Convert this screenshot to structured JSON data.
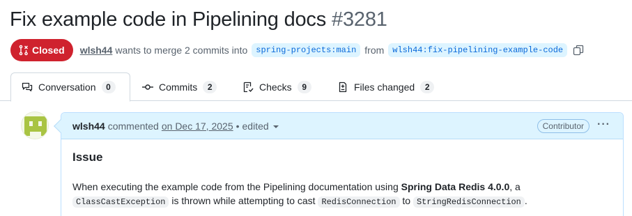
{
  "pr": {
    "title": "Fix example code in Pipelining docs",
    "number": "#3281",
    "state": "Closed",
    "author": "wlsh44",
    "merge_text": "wants to merge 2 commits into",
    "base_branch": "spring-projects:main",
    "from_text": "from",
    "head_branch": "wlsh44:fix-pipelining-example-code"
  },
  "tabs": [
    {
      "label": "Conversation",
      "count": "0",
      "icon": "comment-discussion-icon"
    },
    {
      "label": "Commits",
      "count": "2",
      "icon": "git-commit-icon"
    },
    {
      "label": "Checks",
      "count": "9",
      "icon": "checklist-icon"
    },
    {
      "label": "Files changed",
      "count": "2",
      "icon": "file-diff-icon"
    }
  ],
  "comment": {
    "author": "wlsh44",
    "action": "commented",
    "date": "on Dec 17, 2025",
    "sep": "•",
    "edited": "edited",
    "badge": "Contributor",
    "menu": "···",
    "heading": "Issue",
    "p1": "When executing the example code from the Pipelining documentation using ",
    "p1_strong": "Spring Data Redis 4.0.0",
    "p1_end": ", a",
    "code1": "ClassCastException",
    "p2": " is thrown while attempting to cast ",
    "code2": "RedisConnection",
    "p3": " to ",
    "code3": "StringRedisConnection",
    "p4": "."
  },
  "colors": {
    "closed": "#cf222e",
    "link": "#0969da",
    "header_bg": "#ddf4ff"
  }
}
